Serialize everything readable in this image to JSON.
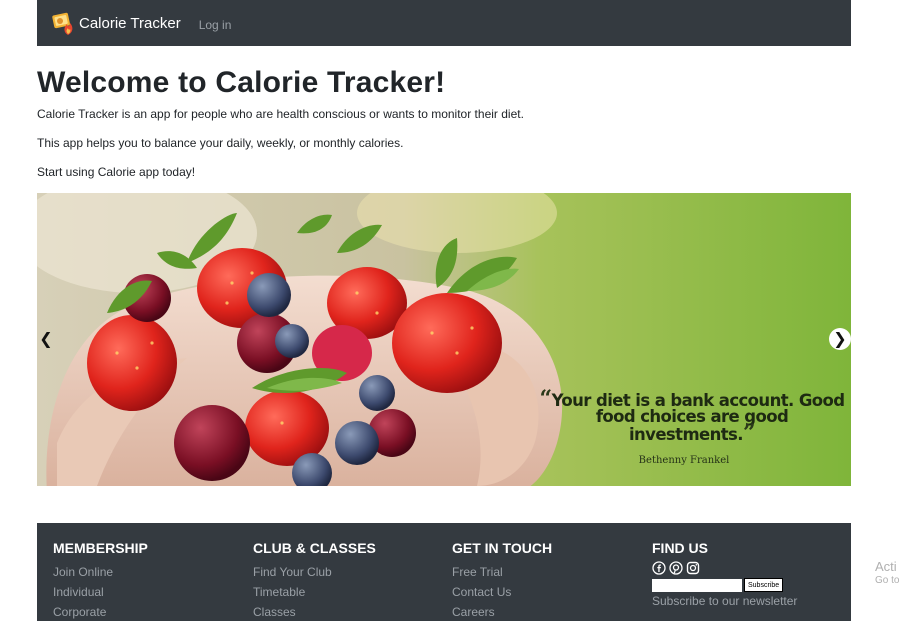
{
  "navbar": {
    "brand": "Calorie Tracker",
    "brand_icon": "calorie-logo-icon",
    "login_link": "Log in"
  },
  "hero": {
    "title": "Welcome to Calorie Tracker!",
    "line1": "Calorie Tracker is an app for people who are health conscious or wants to monitor their diet.",
    "line2": "This app helps you to balance your daily, weekly, or monthly calories.",
    "line3": "Start using Calorie app today!"
  },
  "carousel": {
    "quote": "Your diet is a bank account. Good food choices are good investments.",
    "author": "Bethenny Frankel",
    "prev_icon": "chevron-left-icon",
    "next_icon": "chevron-right-icon"
  },
  "footer": {
    "membership": {
      "heading": "MEMBERSHIP",
      "links": [
        "Join Online",
        "Individual",
        "Corporate"
      ]
    },
    "club": {
      "heading": "CLUB & CLASSES",
      "links": [
        "Find Your Club",
        "Timetable",
        "Classes"
      ]
    },
    "contact": {
      "heading": "GET IN TOUCH",
      "links": [
        "Free Trial",
        "Contact Us",
        "Careers"
      ]
    },
    "find_us": {
      "heading": "FIND US",
      "icons": [
        "facebook-icon",
        "pinterest-icon",
        "instagram-icon"
      ],
      "subscribe_button": "Subscribe",
      "subscribe_text": "Subscribe to our newsletter"
    }
  },
  "watermark": {
    "line1": "Acti",
    "line2": "Go to"
  },
  "colors": {
    "navbar_bg": "#343a40",
    "footer_bg": "#343a40",
    "muted_link": "#9aa0a6"
  }
}
